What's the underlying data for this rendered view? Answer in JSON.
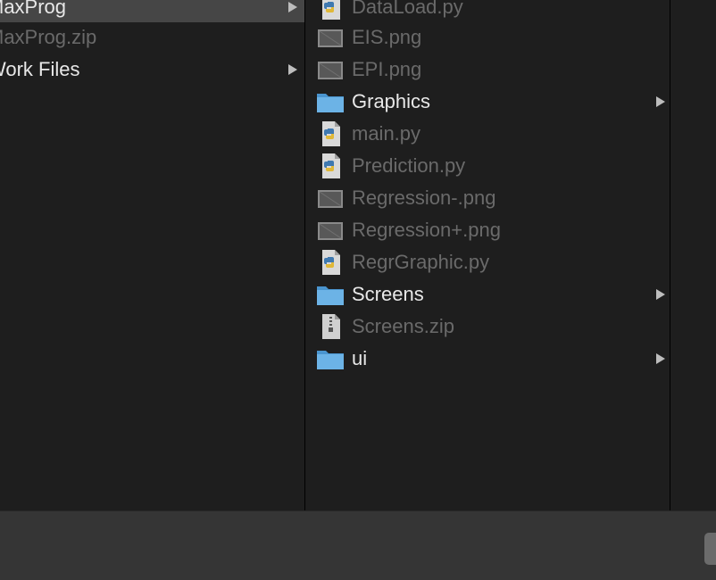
{
  "column1": {
    "items": [
      {
        "label": "MaxProg",
        "kind": "folder",
        "selected": true,
        "has_children": true
      },
      {
        "label": "MaxProg.zip",
        "kind": "file",
        "selected": false,
        "has_children": false
      },
      {
        "label": "Work Files",
        "kind": "folder",
        "selected": false,
        "has_children": true
      }
    ]
  },
  "column2": {
    "items": [
      {
        "label": "DataLoad.py",
        "icon": "python-file-icon",
        "kind": "file"
      },
      {
        "label": "EIS.png",
        "icon": "image-file-icon",
        "kind": "file"
      },
      {
        "label": "EPI.png",
        "icon": "image-file-icon",
        "kind": "file"
      },
      {
        "label": "Graphics",
        "icon": "folder-icon",
        "kind": "folder"
      },
      {
        "label": "main.py",
        "icon": "python-file-icon",
        "kind": "file"
      },
      {
        "label": "Prediction.py",
        "icon": "python-file-icon",
        "kind": "file"
      },
      {
        "label": "Regression-.png",
        "icon": "image-file-icon",
        "kind": "file"
      },
      {
        "label": "Regression+.png",
        "icon": "image-file-icon",
        "kind": "file"
      },
      {
        "label": "RegrGraphic.py",
        "icon": "python-file-icon",
        "kind": "file"
      },
      {
        "label": "Screens",
        "icon": "folder-icon",
        "kind": "folder"
      },
      {
        "label": "Screens.zip",
        "icon": "zip-file-icon",
        "kind": "file"
      },
      {
        "label": "ui",
        "icon": "folder-icon",
        "kind": "folder"
      }
    ]
  },
  "colors": {
    "background": "#1e1e1e",
    "selected_row": "#464646",
    "folder_text": "#e8e8e8",
    "file_text": "#6a6a6a",
    "folder_icon": "#6cb3e6",
    "bottom_bar": "#353535"
  }
}
